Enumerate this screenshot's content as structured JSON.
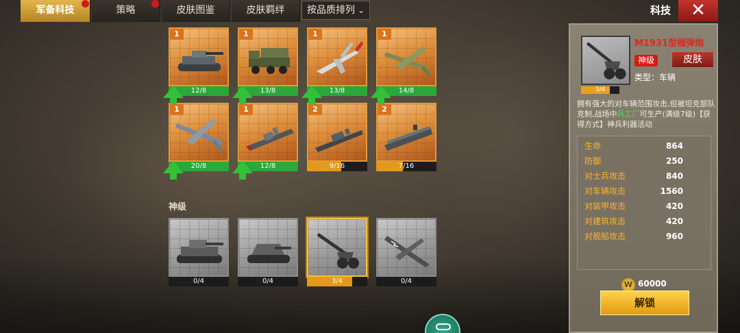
{
  "tabs": [
    {
      "label": "军备科技",
      "active": true,
      "dot": true
    },
    {
      "label": "策略",
      "active": false,
      "dot": true
    },
    {
      "label": "皮肤图鉴",
      "active": false,
      "dot": false
    },
    {
      "label": "皮肤羁绊",
      "active": false,
      "dot": false
    }
  ],
  "sort_label": "按品质排列",
  "header_title": "科技",
  "close_label": "✕",
  "section_label": "神级",
  "row1": [
    {
      "badge": "1",
      "progress": "12/8",
      "ratio": 1.0,
      "upgradable": true,
      "unit": "tank-icon"
    },
    {
      "badge": "1",
      "progress": "13/8",
      "ratio": 1.0,
      "upgradable": true,
      "unit": "rocket-truck-icon"
    },
    {
      "badge": "1",
      "progress": "13/8",
      "ratio": 1.0,
      "upgradable": true,
      "unit": "jet-fighter-icon"
    },
    {
      "badge": "1",
      "progress": "14/8",
      "ratio": 1.0,
      "upgradable": true,
      "unit": "bomber-icon"
    }
  ],
  "row2": [
    {
      "badge": "1",
      "progress": "20/8",
      "ratio": 1.0,
      "upgradable": true,
      "unit": "heavy-bomber-icon"
    },
    {
      "badge": "1",
      "progress": "12/8",
      "ratio": 1.0,
      "upgradable": true,
      "unit": "cruiser-icon"
    },
    {
      "badge": "2",
      "progress": "9/16",
      "ratio": 0.5625,
      "upgradable": false,
      "unit": "battleship-icon"
    },
    {
      "badge": "2",
      "progress": "7/16",
      "ratio": 0.4375,
      "upgradable": false,
      "unit": "carrier-icon"
    }
  ],
  "row3": [
    {
      "progress": "0/4",
      "ratio": 0.0,
      "selected": false,
      "unit": "heavy-tank-icon"
    },
    {
      "progress": "0/4",
      "ratio": 0.0,
      "selected": false,
      "unit": "assault-gun-icon"
    },
    {
      "progress": "3/4",
      "ratio": 0.75,
      "selected": true,
      "unit": "howitzer-icon"
    },
    {
      "progress": "0/4",
      "ratio": 0.0,
      "selected": false,
      "unit": "shark-fighter-icon"
    }
  ],
  "detail": {
    "name": "M1931型榴弹炮",
    "grade": "神级",
    "skin_label": "皮肤",
    "type_line": "类型：车辆",
    "progress": "3/4",
    "ratio": 0.75,
    "desc_a": "拥有强大的对车辆范围攻击,但被坦克部队克制,战场中",
    "desc_highlight": "兵工厂",
    "desc_b": "可生产(满级7级)【获得方式】神兵利器活动",
    "stats": [
      {
        "label": "生命",
        "value": "864"
      },
      {
        "label": "防御",
        "value": "250"
      },
      {
        "label": "对士兵攻击",
        "value": "840"
      },
      {
        "label": "对车辆攻击",
        "value": "1560"
      },
      {
        "label": "对装甲攻击",
        "value": "420"
      },
      {
        "label": "对建筑攻击",
        "value": "420"
      },
      {
        "label": "对舰船攻击",
        "value": "960"
      }
    ],
    "coin_symbol": "W",
    "price": "60000",
    "unlock_label": "解锁"
  },
  "colors": {
    "active_tab": "#e2b54c",
    "progress_green": "#2aa83a",
    "progress_orange": "#e39a1c",
    "grade_red": "#d31b16"
  }
}
